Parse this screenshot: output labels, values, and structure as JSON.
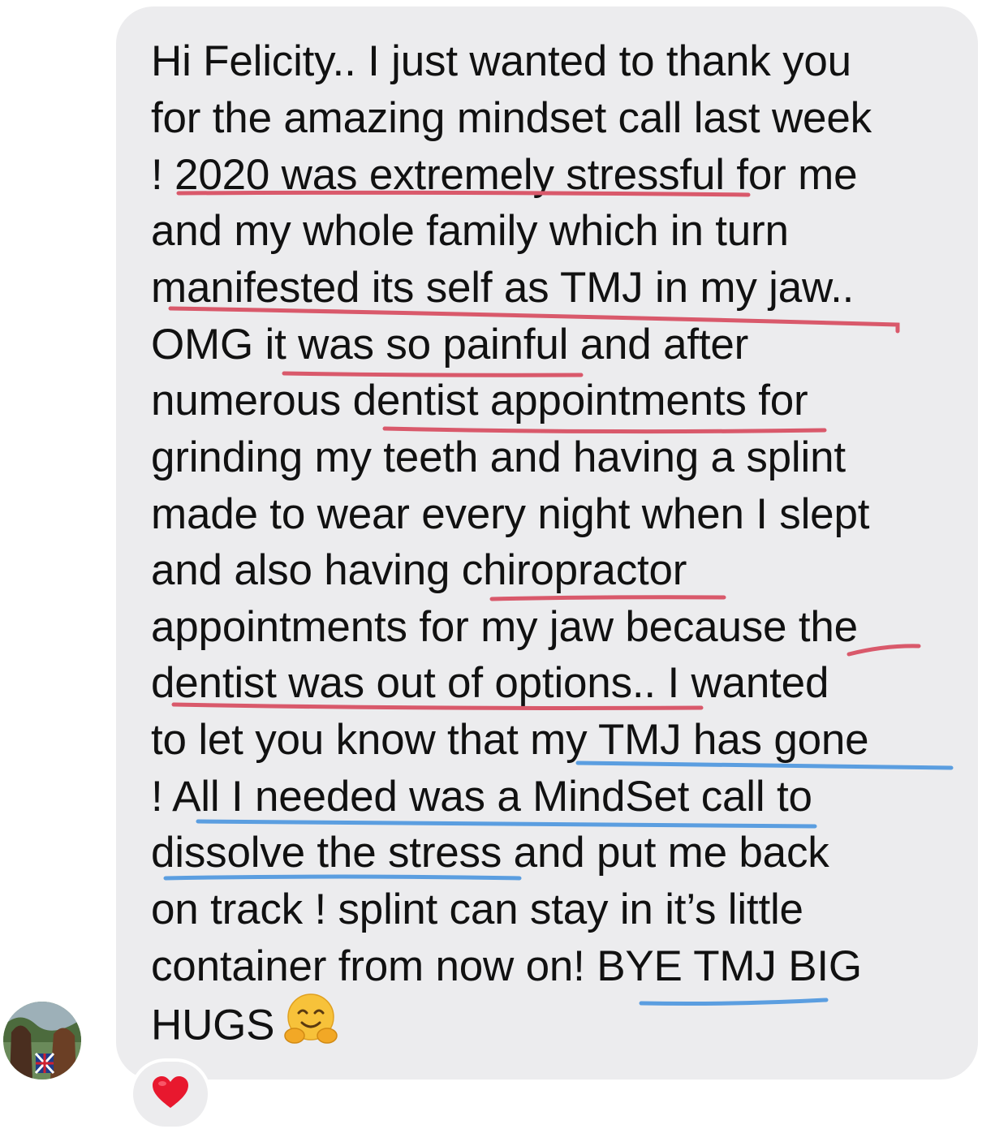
{
  "message": {
    "lines": [
      "Hi Felicity.. I just wanted to thank you",
      "for the amazing mindset call last week",
      "! 2020 was extremely stressful for me",
      "and my whole family which in turn",
      "manifested its self as TMJ in my jaw..",
      "OMG it was so painful and after",
      "numerous dentist appointments for",
      "grinding my teeth and having a splint",
      "made to wear every night when I slept",
      "and also having chiropractor",
      "appointments for my jaw because the",
      "dentist was out of options.. I wanted",
      "to let you know that my TMJ has gone",
      "! All I needed was a MindSet call to",
      "dissolve the stress and put me back",
      "on track ! splint can stay in it’s little",
      "container from now on! BYE TMJ BIG",
      "HUGS"
    ],
    "emoji": "hugging-face-icon"
  },
  "reaction": {
    "icon": "red-heart-icon"
  },
  "colors": {
    "bubble": "#ececee",
    "text": "#111111",
    "underline_red": "#d9596b",
    "underline_blue": "#5b9ee0",
    "heart": "#e8182e"
  }
}
